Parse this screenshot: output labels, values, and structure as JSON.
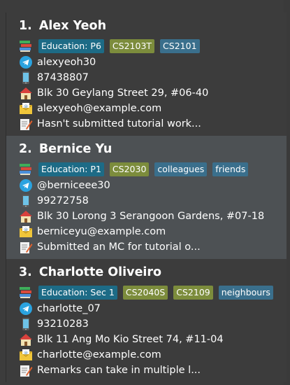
{
  "persons": [
    {
      "index": "1.",
      "name": "Alex Yeoh",
      "tags": [
        {
          "label": "Education: P6",
          "kind": "edu"
        },
        {
          "label": "CS2103T",
          "kind": "course"
        },
        {
          "label": "CS2101",
          "kind": "misc"
        }
      ],
      "telegram": "alexyeoh30",
      "phone": "87438807",
      "address": "Blk 30 Geylang Street 29, #06-40",
      "email": "alexyeoh@example.com",
      "remark": "Hasn't submitted tutorial work..."
    },
    {
      "index": "2.",
      "name": "Bernice Yu",
      "tags": [
        {
          "label": "Education: P1",
          "kind": "edu"
        },
        {
          "label": "CS2030",
          "kind": "course"
        },
        {
          "label": "colleagues",
          "kind": "misc"
        },
        {
          "label": "friends",
          "kind": "misc"
        }
      ],
      "telegram": "@berniceee30",
      "phone": "99272758",
      "address": "Blk 30 Lorong 3 Serangoon Gardens, #07-18",
      "email": "berniceyu@example.com",
      "remark": "Submitted an MC for tutorial o..."
    },
    {
      "index": "3.",
      "name": "Charlotte Oliveiro",
      "tags": [
        {
          "label": "Education: Sec 1",
          "kind": "edu"
        },
        {
          "label": "CS2040S",
          "kind": "course"
        },
        {
          "label": "CS2109",
          "kind": "course"
        },
        {
          "label": "neighbours",
          "kind": "misc"
        }
      ],
      "telegram": "charlotte_07",
      "phone": "93210283",
      "address": "Blk 11 Ang Mo Kio Street 74, #11-04",
      "email": "charlotte@example.com",
      "remark": "Remarks can take in multiple l..."
    }
  ],
  "colors": {
    "background": "#3c3c3c",
    "selected": "#4d5154",
    "tag_edu": "#1d6b86",
    "tag_course": "#7c8c3c",
    "tag_misc": "#3a6f8c"
  }
}
